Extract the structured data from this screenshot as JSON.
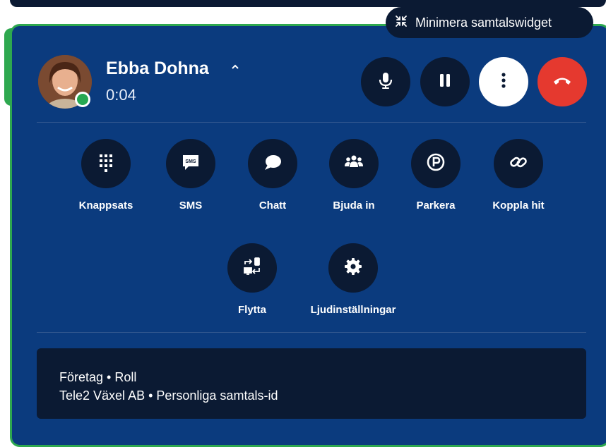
{
  "minimize": {
    "label": "Minimera samtalswidget",
    "icon": "minimize-arrows-icon"
  },
  "caller": {
    "name": "Ebba Dohna",
    "timer": "0:04",
    "presence_color": "#26a852"
  },
  "controls": [
    {
      "icon": "microphone-icon"
    },
    {
      "icon": "pause-icon"
    },
    {
      "icon": "more-vertical-icon"
    },
    {
      "icon": "hang-up-icon"
    }
  ],
  "actions": [
    {
      "label": "Knappsats",
      "icon": "keypad-icon"
    },
    {
      "label": "SMS",
      "icon": "sms-icon"
    },
    {
      "label": "Chatt",
      "icon": "chat-bubble-icon"
    },
    {
      "label": "Bjuda in",
      "icon": "people-icon"
    },
    {
      "label": "Parkera",
      "icon": "parking-icon"
    },
    {
      "label": "Koppla hit",
      "icon": "link-icon"
    },
    {
      "label": "Flytta",
      "icon": "transfer-device-icon"
    },
    {
      "label": "Ljudinställningar",
      "icon": "gear-icon"
    }
  ],
  "info": {
    "line1": "Företag • Roll",
    "line2": "Tele2 Växel AB • Personliga samtals-id"
  },
  "colors": {
    "panel": "#0b3b7e",
    "dark_circle": "#0b1a33",
    "hangup": "#e5392f",
    "accent_border": "#2ea84f"
  }
}
